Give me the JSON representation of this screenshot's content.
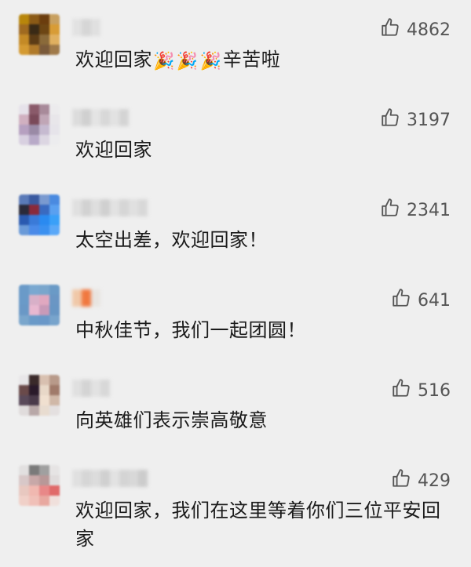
{
  "comments": [
    {
      "text": "欢迎回家",
      "emojis": [
        "🎉",
        "🎉",
        "🎉"
      ],
      "text_after": "辛苦啦",
      "likes": "4862"
    },
    {
      "text": "欢迎回家",
      "likes": "3197"
    },
    {
      "text": "太空出差，欢迎回家！",
      "likes": "2341"
    },
    {
      "text": "中秋佳节，我们一起团圆！",
      "likes": "641"
    },
    {
      "text": "向英雄们表示崇高敬意",
      "likes": "516"
    },
    {
      "text": "欢迎回家，我们在这里等着你们三位平安回家",
      "likes": "429"
    }
  ],
  "icons": {
    "like": "thumbs-up-icon"
  },
  "colors": {
    "background": "#efefef",
    "text": "#1b1b1b",
    "like_text": "#555555"
  }
}
